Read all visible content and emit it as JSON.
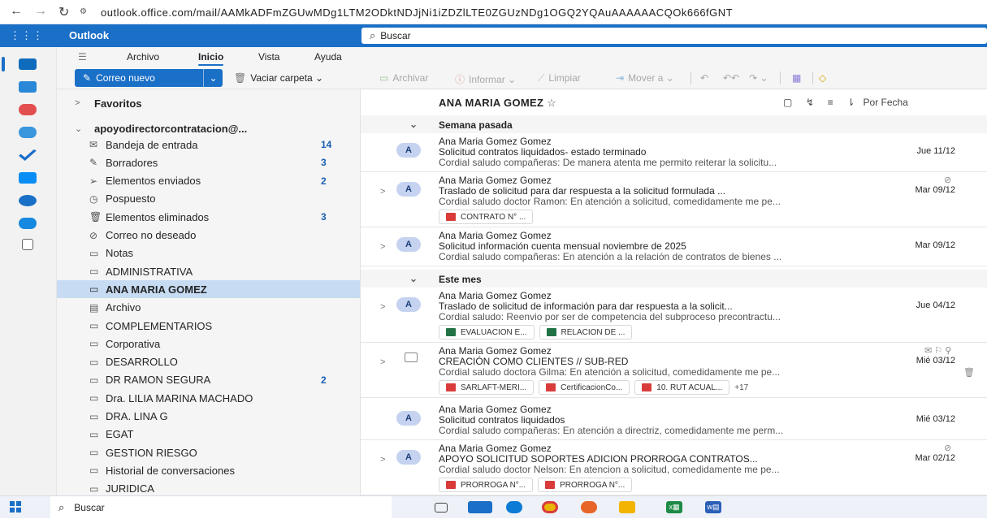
{
  "browser": {
    "back": "←",
    "forward": "→",
    "reload": "↻",
    "url": "outlook.office.com/mail/AAMkADFmZGUwMDg1LTM2ODktNDJjNi1iZDZlLTE0ZGUzNDg1OGQ2YQAuAAAAAACQOk666fGNT"
  },
  "app": {
    "name": "Outlook",
    "search_placeholder": "Buscar"
  },
  "ribbon": {
    "tabs": [
      "Archivo",
      "Inicio",
      "Vista",
      "Ayuda"
    ],
    "active_tab": "Inicio",
    "new_mail": "Correo nuevo",
    "empty_folder": "Vaciar carpeta",
    "archive": "Archivar",
    "report": "Informar",
    "clean": "Limpiar",
    "move_to": "Mover a"
  },
  "folders": {
    "favorites": "Favoritos",
    "account": "apoyodirectorcontratacion@...",
    "items": [
      {
        "label": "Bandeja de entrada",
        "count": "14",
        "icon": "inbox-icon"
      },
      {
        "label": "Borradores",
        "count": "3",
        "icon": "draft-icon"
      },
      {
        "label": "Elementos enviados",
        "count": "2",
        "icon": "sent-icon"
      },
      {
        "label": "Pospuesto",
        "count": "",
        "icon": "clock-icon"
      },
      {
        "label": "Elementos eliminados",
        "count": "3",
        "icon": "trash-icon"
      },
      {
        "label": "Correo no deseado",
        "count": "",
        "icon": "junk-icon"
      },
      {
        "label": "Notas",
        "count": "",
        "icon": "note-icon"
      },
      {
        "label": "ADMINISTRATIVA",
        "count": "",
        "icon": "folder-icon"
      },
      {
        "label": "ANA MARIA GOMEZ",
        "count": "",
        "icon": "folder-icon",
        "selected": true
      },
      {
        "label": "Archivo",
        "count": "",
        "icon": "archive-icon"
      },
      {
        "label": "COMPLEMENTARIOS",
        "count": "",
        "icon": "folder-icon"
      },
      {
        "label": "Corporativa",
        "count": "",
        "icon": "folder-icon"
      },
      {
        "label": "DESARROLLO",
        "count": "",
        "icon": "folder-icon"
      },
      {
        "label": "DR RAMON SEGURA",
        "count": "2",
        "icon": "folder-icon"
      },
      {
        "label": "Dra. LILIA MARINA MACHADO",
        "count": "",
        "icon": "folder-icon"
      },
      {
        "label": "DRA. LINA G",
        "count": "",
        "icon": "folder-icon"
      },
      {
        "label": "EGAT",
        "count": "",
        "icon": "folder-icon"
      },
      {
        "label": "GESTION RIESGO",
        "count": "",
        "icon": "folder-icon"
      },
      {
        "label": "Historial de conversaciones",
        "count": "",
        "icon": "folder-icon"
      },
      {
        "label": "JURIDICA",
        "count": "",
        "icon": "folder-icon"
      }
    ]
  },
  "list": {
    "title": "ANA MARIA GOMEZ",
    "sort_label": "Por Fecha",
    "groups": [
      "Semana pasada",
      "Este mes"
    ],
    "messages": [
      {
        "sender": "Ana Maria Gomez Gomez",
        "subject": "Solicitud contratos liquidados- estado terminado",
        "date": "Jue 11/12",
        "preview": "Cordial saludo compañeras: De manera atenta me permito reiterar la solicitu...",
        "attachments": [],
        "more": ""
      },
      {
        "sender": "Ana Maria Gomez Gomez",
        "subject": "Traslado de solicitud para dar respuesta a la solicitud formulada ...",
        "date": "Mar 09/12",
        "preview": "Cordial saludo doctor Ramon: En atención a solicitud, comedidamente me pe...",
        "attachments": [
          "CONTRATO N° ..."
        ],
        "more": ""
      },
      {
        "sender": "Ana Maria Gomez Gomez",
        "subject": "Solicitud información cuenta mensual noviembre de 2025",
        "date": "Mar 09/12",
        "preview": "Cordial saludo compañeras: En atención a la relación de contratos de bienes ...",
        "attachments": [],
        "more": ""
      },
      {
        "sender": "Ana Maria Gomez Gomez",
        "subject": "Traslado de solicitud de información para dar respuesta a la solicit...",
        "date": "Jue 04/12",
        "preview": "Cordial saludo: Reenvio por ser de competencia del subproceso precontractu...",
        "attachments": [
          "EVALUACION E...",
          "RELACION DE ..."
        ],
        "more": ""
      },
      {
        "sender": "Ana Maria Gomez Gomez",
        "subject": "CREACIÓN COMO CLIENTES // SUB-RED",
        "date": "Mié 03/12",
        "preview": "Cordial saludo doctora Gilma: En atención a solicitud, comedidamente me pe...",
        "attachments": [
          "SARLAFT-MERI...",
          "CertificacionCo...",
          "10. RUT ACUAL..."
        ],
        "more": "+17"
      },
      {
        "sender": "Ana Maria Gomez Gomez",
        "subject": "Solicitud contratos liquidados",
        "date": "Mié 03/12",
        "preview": "Cordial saludo compañeras: En atención a directriz, comedidamente me perm...",
        "attachments": [],
        "more": ""
      },
      {
        "sender": "Ana Maria Gomez Gomez",
        "subject": "APOYO SOLICITUD SOPORTES ADICION PRORROGA CONTRATOS...",
        "date": "Mar 02/12",
        "preview": "Cordial saludo doctor Nelson: En atencion a solicitud, comedidamente me pe...",
        "attachments": [
          "PRORROGA N°...",
          "PRORROGA N°..."
        ],
        "more": ""
      }
    ]
  },
  "taskbar": {
    "search_placeholder": "Buscar"
  },
  "avatar_initial": "A"
}
